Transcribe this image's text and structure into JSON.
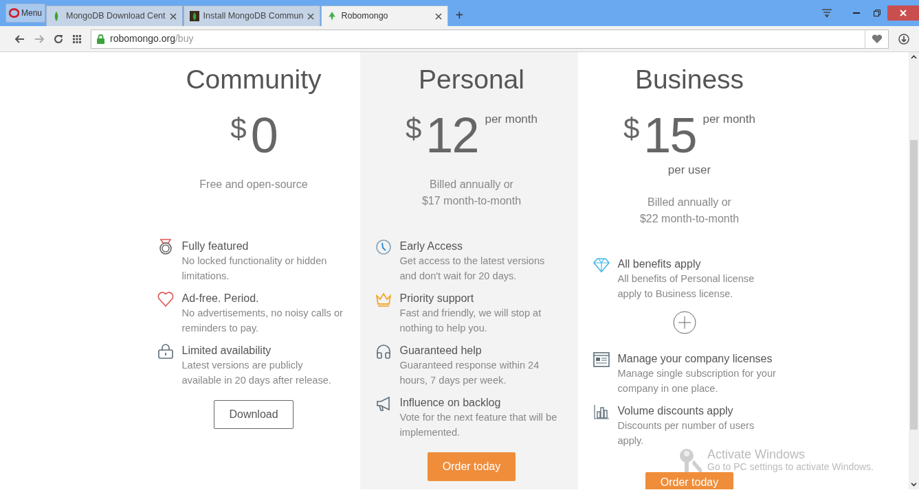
{
  "browser": {
    "menu_label": "Menu",
    "tabs": [
      {
        "label": "MongoDB Download Cent",
        "selected": false
      },
      {
        "label": "Install MongoDB Commun",
        "selected": false
      },
      {
        "label": "Robomongo",
        "selected": true
      }
    ],
    "new_tab": "+",
    "address": {
      "host": "robomongo.org",
      "path": "/buy"
    }
  },
  "plans": [
    {
      "name": "Community",
      "currency": "$",
      "price": "0",
      "note_lines": [
        "Free and open-source"
      ],
      "feature_groups": [
        [
          {
            "title": "Fully featured",
            "text": "No locked functionality or hidden limitations."
          },
          {
            "title": "Ad-free. Period.",
            "text": "No advertisements, no noisy calls or reminders to pay."
          },
          {
            "title": "Limited availability",
            "text": "Latest versions are publicly available in 20 days after release."
          }
        ]
      ],
      "highlighted": false,
      "button": {
        "label": "Download",
        "kind": "outline"
      }
    },
    {
      "name": "Personal",
      "currency": "$",
      "price": "12",
      "period": "per month",
      "note_lines": [
        "Billed annually or",
        "$17 month-to-month"
      ],
      "feature_groups": [
        [
          {
            "title": "Early Access",
            "text": "Get access to the latest versions and don't wait for 20 days."
          },
          {
            "title": "Priority support",
            "text": "Fast and friendly, we will stop at nothing to help you."
          },
          {
            "title": "Guaranteed help",
            "text": "Guaranteed response within 24 hours, 7 days per week."
          },
          {
            "title": "Influence on backlog",
            "text": "Vote for the next feature that will be implemented."
          }
        ]
      ],
      "highlighted": true,
      "button": {
        "label": "Order today",
        "kind": "solid"
      }
    },
    {
      "name": "Business",
      "currency": "$",
      "price": "15",
      "period": "per month",
      "unit": "per user",
      "note_lines": [
        "Billed annually or",
        "$22 month-to-month"
      ],
      "feature_groups": [
        [
          {
            "title": "All benefits apply",
            "text": "All benefits of Personal license apply to Business license."
          }
        ],
        [
          {
            "title": "Manage your company licenses",
            "text": "Manage single subscription for your company in one place."
          },
          {
            "title": "Volume discounts apply",
            "text": "Discounts per number of users apply."
          }
        ]
      ],
      "highlighted": false,
      "button": {
        "label": "Order today",
        "kind": "solid"
      }
    }
  ],
  "os_notice": {
    "title": "Activate Windows",
    "text": "Go to PC settings to activate Windows."
  }
}
